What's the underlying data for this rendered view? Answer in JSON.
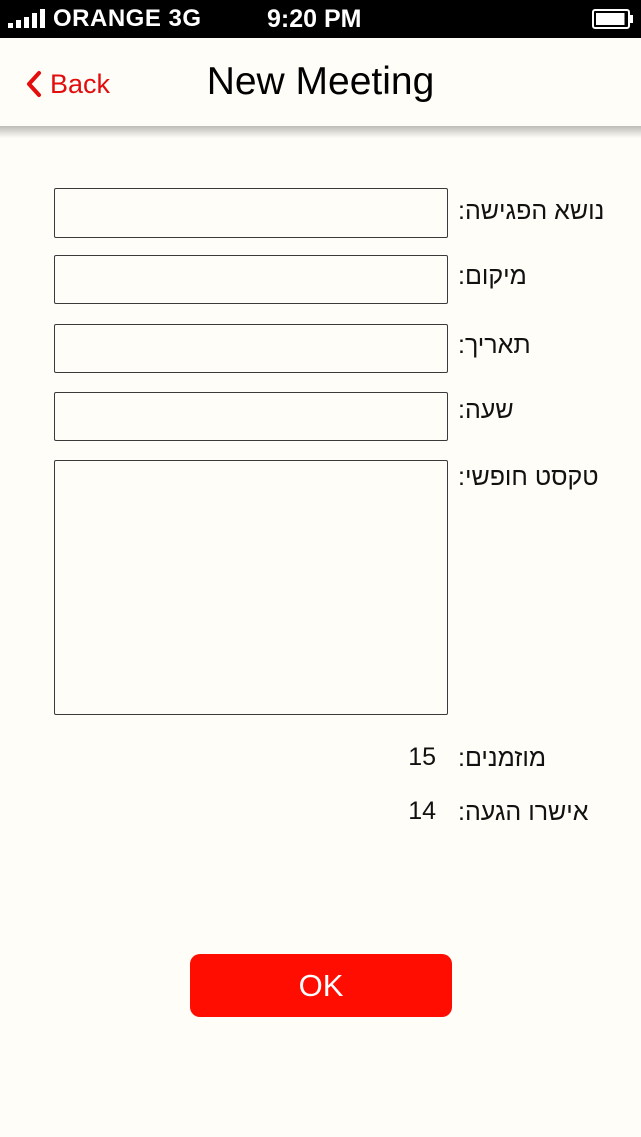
{
  "status_bar": {
    "carrier": "ORANGE",
    "network": "3G",
    "time": "9:20 PM",
    "battery_level": 0.95,
    "signal_bars": 5
  },
  "nav": {
    "back_label": "Back",
    "title": "New Meeting"
  },
  "form": {
    "subject_label": "נושא הפגישה:",
    "subject_value": "",
    "location_label": "מיקום:",
    "location_value": "",
    "date_label": "תאריך:",
    "date_value": "",
    "time_label": "שעה:",
    "time_value": "",
    "free_text_label": "טקסט חופשי:",
    "free_text_value": ""
  },
  "stats": {
    "invited_label": "מוזמנים:",
    "invited_count": "15",
    "confirmed_label": "אישרו הגעה:",
    "confirmed_count": "14"
  },
  "actions": {
    "ok_label": "OK"
  },
  "colors": {
    "accent": "#e30d0d",
    "ok_button": "#ff0d00",
    "background": "#fefdf8"
  }
}
